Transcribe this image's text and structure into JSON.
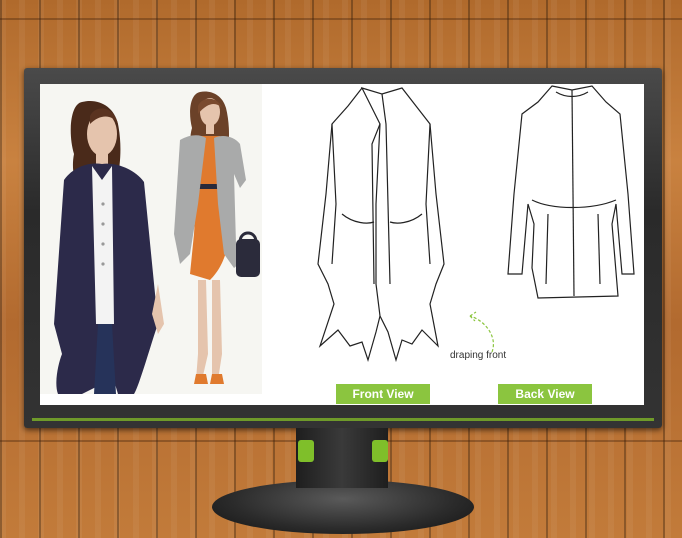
{
  "buttons": {
    "front": "Front View",
    "back": "Back View"
  },
  "annotation": "draping front",
  "colors": {
    "accent_green": "#8bc53f",
    "cardigan_navy": "#2c2a4a",
    "cardigan_grey": "#a9aaaa",
    "dress_orange": "#e07a2e",
    "wood": "#b8733a"
  },
  "icons": [
    "stand-clip-icon"
  ]
}
